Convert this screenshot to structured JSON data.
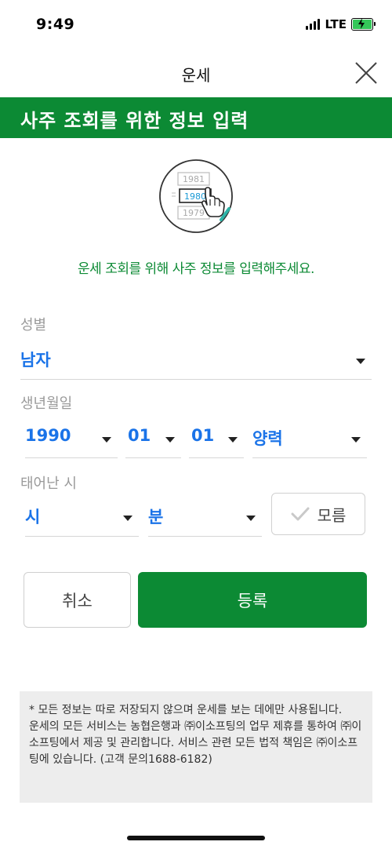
{
  "status_bar": {
    "time": "9:49",
    "network": "LTE",
    "battery_level": 0.9
  },
  "nav": {
    "title": "운세",
    "close_icon": "close-icon"
  },
  "banner": {
    "title": "사주 조회를 위한 정보 입력"
  },
  "illustration": {
    "years": [
      "1981",
      "1980",
      "1979"
    ],
    "icon": "hand-pointer-icon"
  },
  "guide_text": "운세 조회를 위해 사주 정보를 입력해주세요.",
  "gender": {
    "label": "성별",
    "value": "남자"
  },
  "birth": {
    "label": "생년월일",
    "year": "1990",
    "month": "01",
    "day": "01",
    "calendar": "양력"
  },
  "birth_time": {
    "label": "태어난 시",
    "hour": "시",
    "minute": "분",
    "unknown_label": "모름"
  },
  "buttons": {
    "cancel": "취소",
    "register": "등록"
  },
  "notice": {
    "line1": "* 모든 정보는 따로 저장되지 않으며 운세를 보는 데에만 사용됩니다.",
    "line2": "운세의 모든 서비스는 농협은행과 ㈜이소프팅의 업무 제휴를 통하여 ㈜이소프팅에서 제공 및 관리합니다. 서비스 관련 모든 법적 책임은 ㈜이소프팅에 있습니다. (고객 문의1688-6182)"
  },
  "colors": {
    "brand_green": "#0c8a34",
    "value_blue": "#1a73e8"
  }
}
